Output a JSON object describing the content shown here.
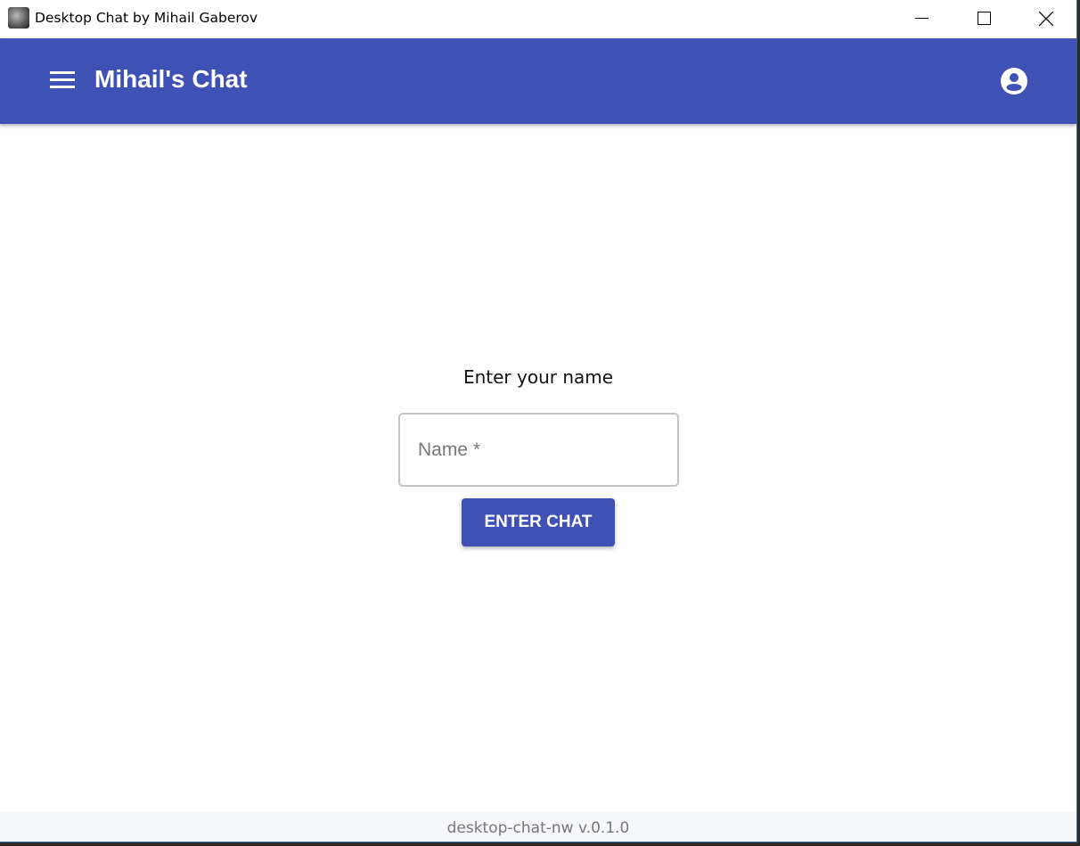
{
  "window": {
    "title": "Desktop Chat by Mihail Gaberov"
  },
  "appbar": {
    "title": "Mihail's Chat",
    "menu_icon": "menu-icon",
    "account_icon": "account-circle-icon",
    "color": "#3f51b5"
  },
  "login": {
    "prompt": "Enter your name",
    "name_placeholder": "Name *",
    "name_value": "",
    "enter_button": "ENTER CHAT"
  },
  "footer": {
    "version": "desktop-chat-nw v.0.1.0"
  }
}
